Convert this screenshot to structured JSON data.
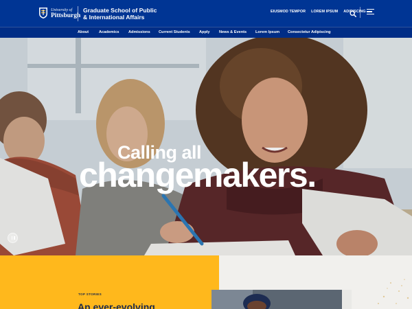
{
  "header": {
    "logo_line1": "University of",
    "logo_line2": "Pittsburgh",
    "school_name": "Graduate School of Public & International Affairs",
    "util_links": [
      "EIUSMOD TEMPOR",
      "LOREM IPSUM",
      "ADIPISCING"
    ],
    "icons": [
      "shield-icon",
      "search-icon",
      "hamburger-menu-icon"
    ],
    "brand_color": "#003594"
  },
  "nav": {
    "items": [
      "About",
      "Academics",
      "Admissions",
      "Current Students",
      "Apply",
      "News & Events",
      "Lorem Ipsum",
      "Consectetur Adipiscing"
    ]
  },
  "hero": {
    "headline_line1": "Calling all",
    "headline_line2": "changemakers.",
    "pause_icon": "pause-icon"
  },
  "stories": {
    "label": "TOP STORIES",
    "headline": "An ever-evolving",
    "accent_color": "#ffb81c"
  }
}
